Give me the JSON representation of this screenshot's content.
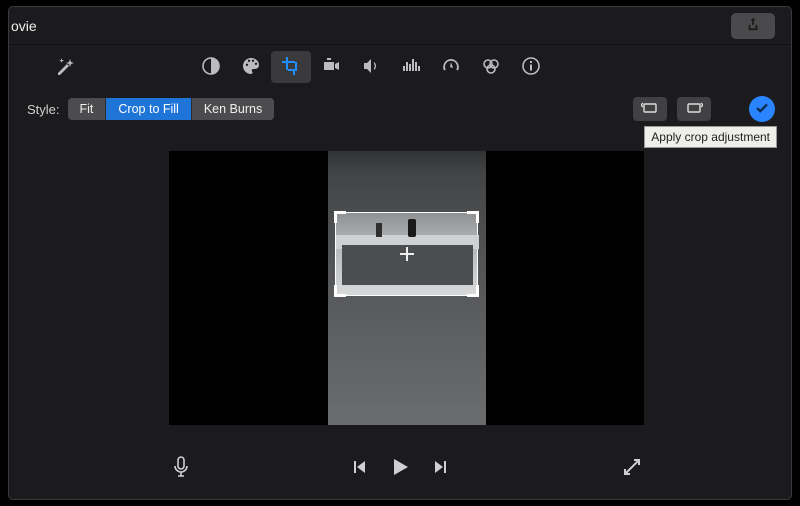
{
  "titlebar": {
    "title": "ovie"
  },
  "toolbar": {
    "items": {
      "wand": "magic-wand",
      "balance": "color-balance",
      "palette": "color-correction",
      "crop": "cropping",
      "stabilize": "stabilization",
      "volume": "volume",
      "eq": "noise-reduction-eq",
      "speed": "speed",
      "filters": "clip-filter-audio-effects",
      "info": "clip-information"
    }
  },
  "styleRow": {
    "label": "Style:",
    "options": {
      "fit": "Fit",
      "crop": "Crop to Fill",
      "ken": "Ken Burns"
    }
  },
  "rightTools": {
    "rotateCCW": "rotate-counterclockwise",
    "rotateCW": "rotate-clockwise",
    "applyTooltip": "Apply crop adjustment"
  },
  "bottom": {
    "mic": "voiceover",
    "prev": "previous-frame",
    "play": "play",
    "next": "next-frame",
    "fullscreen": "fullscreen"
  }
}
